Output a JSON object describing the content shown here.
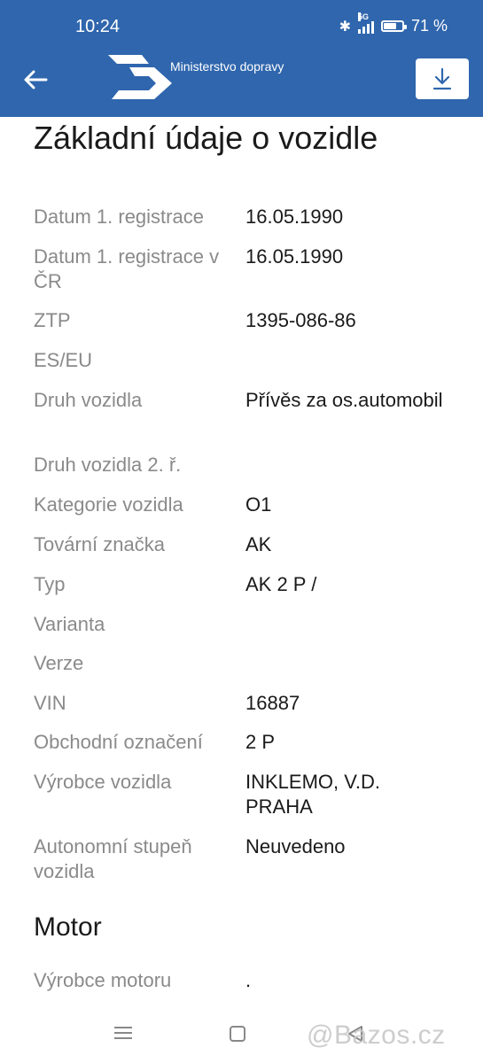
{
  "status_bar": {
    "time": "10:24",
    "network": "5G",
    "battery": "71 %",
    "battery_level": 0.71
  },
  "header": {
    "ministry_name": "Ministerstvo dopravy",
    "back_icon": "arrow-left-icon",
    "download_icon": "download-icon",
    "logo": "ministry-logo",
    "color": "#2f66ad"
  },
  "page_title": "Základní údaje o vozidle",
  "fields": [
    {
      "label": "Datum 1. registrace",
      "value": "16.05.1990"
    },
    {
      "label": "Datum 1. registrace v ČR",
      "value": "16.05.1990"
    },
    {
      "label": "ZTP",
      "value": "1395-086-86"
    },
    {
      "label": "ES/EU",
      "value": ""
    },
    {
      "label": "Druh vozidla",
      "value": "Přívěs za os.automobil"
    },
    {
      "label": "Druh vozidla 2. ř.",
      "value": ""
    },
    {
      "label": "Kategorie vozidla",
      "value": "O1"
    },
    {
      "label": "Tovární značka",
      "value": "AK"
    },
    {
      "label": "Typ",
      "value": "AK 2 P /"
    },
    {
      "label": "Varianta",
      "value": ""
    },
    {
      "label": "Verze",
      "value": ""
    },
    {
      "label": "VIN",
      "value": "16887"
    },
    {
      "label": "Obchodní označení",
      "value": "2 P"
    },
    {
      "label": "Výrobce vozidla",
      "value": "INKLEMO, V.D. PRAHA"
    },
    {
      "label": "Autonomní stupeň vozidla",
      "value": "Neuvedeno"
    }
  ],
  "motor_section": {
    "title": "Motor",
    "fields": [
      {
        "label": "Výrobce motoru",
        "value": "."
      }
    ]
  },
  "nav_bar": {
    "menu_icon": "menu-icon",
    "home_icon": "home-icon",
    "back_icon": "back-triangle-icon"
  },
  "watermark": "@Bazos.cz"
}
